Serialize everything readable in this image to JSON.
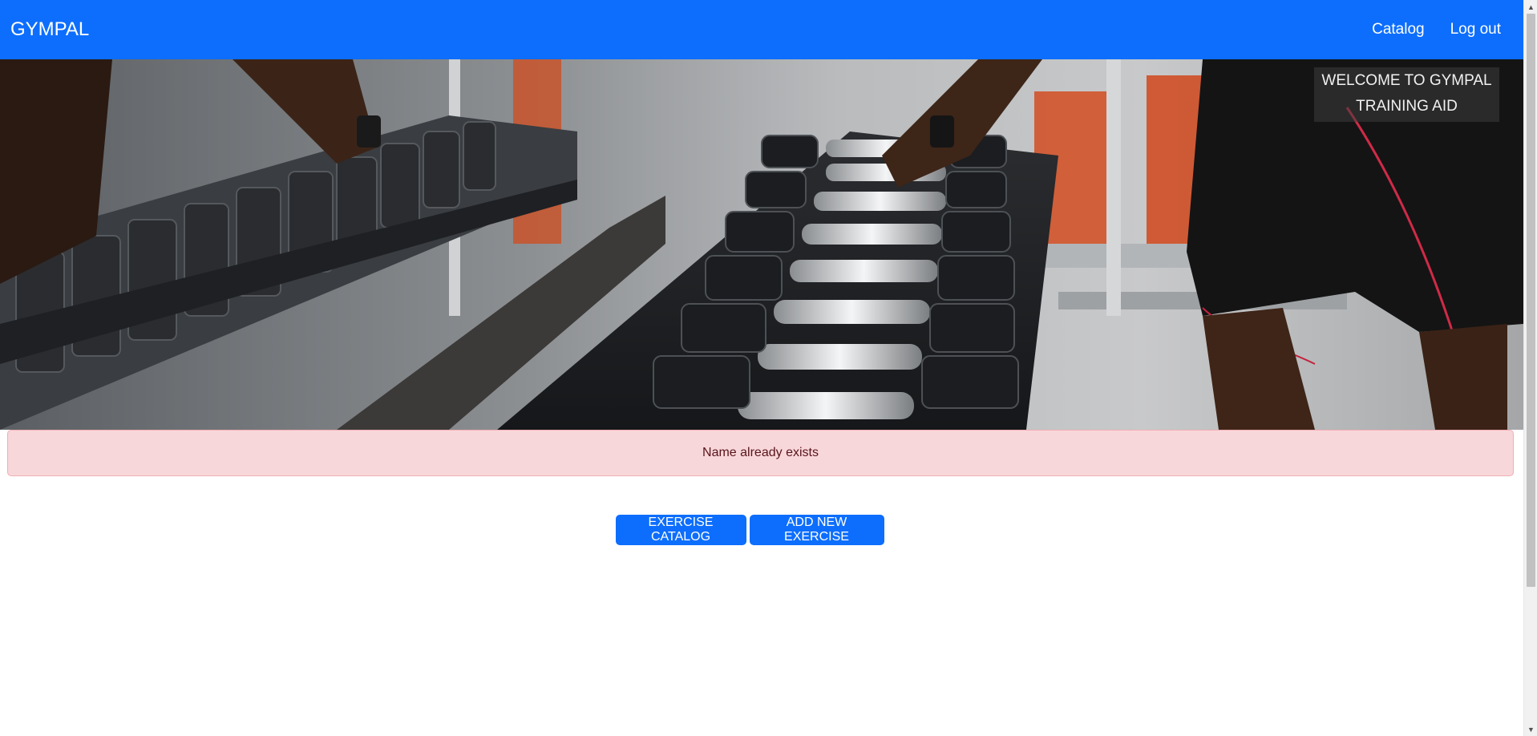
{
  "navbar": {
    "brand": "GYMPAL",
    "links": [
      "Catalog",
      "Log out"
    ],
    "color": "#0d6efd"
  },
  "hero": {
    "image": "gym-dumbbell-rack-photo",
    "welcome_line1": "WELCOME TO GYMPAL",
    "welcome_line2": "TRAINING AID"
  },
  "alert": {
    "message": "Name already exists",
    "type": "danger"
  },
  "actions": {
    "catalog_label": "EXERCISE CATALOG",
    "add_label": "ADD NEW EXERCISE"
  },
  "scrollbar": {
    "up_icon": "chevron-up-icon",
    "down_icon": "chevron-down-icon"
  }
}
